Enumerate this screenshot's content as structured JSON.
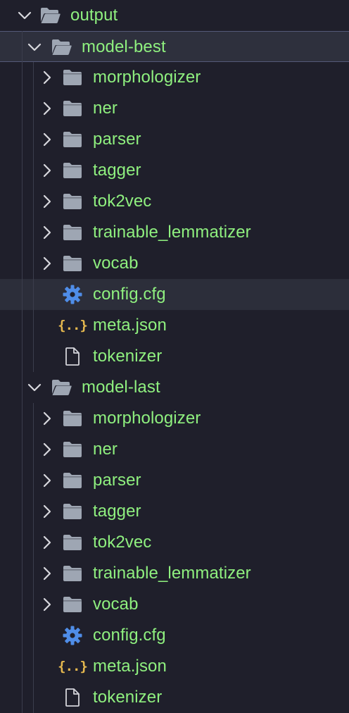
{
  "explorer": {
    "colors": {
      "background": "#1f1f2b",
      "label": "#8ff07f",
      "folder_icon": "#9ea6b3",
      "gear_icon": "#4f8de8",
      "json_icon": "#e6b94f",
      "selection": "#2e303d"
    },
    "root": {
      "label": "output",
      "expanded": true,
      "icon": "folder-open-icon"
    },
    "groups": [
      {
        "label": "model-best",
        "expanded": true,
        "selected": true,
        "icon": "folder-open-icon",
        "children": [
          {
            "label": "morphologizer",
            "type": "folder",
            "icon": "folder-icon"
          },
          {
            "label": "ner",
            "type": "folder",
            "icon": "folder-icon"
          },
          {
            "label": "parser",
            "type": "folder",
            "icon": "folder-icon"
          },
          {
            "label": "tagger",
            "type": "folder",
            "icon": "folder-icon"
          },
          {
            "label": "tok2vec",
            "type": "folder",
            "icon": "folder-icon"
          },
          {
            "label": "trainable_lemmatizer",
            "type": "folder",
            "icon": "folder-icon"
          },
          {
            "label": "vocab",
            "type": "folder",
            "icon": "folder-icon"
          },
          {
            "label": "config.cfg",
            "type": "config",
            "icon": "gear-icon",
            "hovered": true
          },
          {
            "label": "meta.json",
            "type": "json",
            "icon": "json-icon",
            "glyph": "{..}"
          },
          {
            "label": "tokenizer",
            "type": "file",
            "icon": "file-icon"
          }
        ]
      },
      {
        "label": "model-last",
        "expanded": true,
        "selected": false,
        "icon": "folder-open-icon",
        "children": [
          {
            "label": "morphologizer",
            "type": "folder",
            "icon": "folder-icon"
          },
          {
            "label": "ner",
            "type": "folder",
            "icon": "folder-icon"
          },
          {
            "label": "parser",
            "type": "folder",
            "icon": "folder-icon"
          },
          {
            "label": "tagger",
            "type": "folder",
            "icon": "folder-icon"
          },
          {
            "label": "tok2vec",
            "type": "folder",
            "icon": "folder-icon"
          },
          {
            "label": "trainable_lemmatizer",
            "type": "folder",
            "icon": "folder-icon"
          },
          {
            "label": "vocab",
            "type": "folder",
            "icon": "folder-icon"
          },
          {
            "label": "config.cfg",
            "type": "config",
            "icon": "gear-icon"
          },
          {
            "label": "meta.json",
            "type": "json",
            "icon": "json-icon",
            "glyph": "{..}"
          },
          {
            "label": "tokenizer",
            "type": "file",
            "icon": "file-icon"
          }
        ]
      }
    ]
  }
}
